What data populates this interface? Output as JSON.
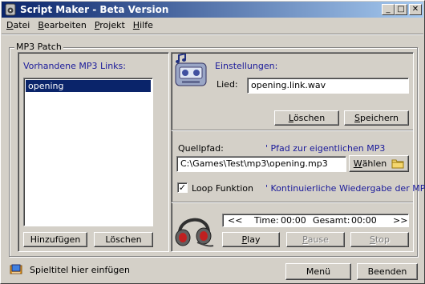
{
  "window": {
    "title": "Script Maker - Beta Version"
  },
  "titlebar": {
    "minimize": "_",
    "maximize": "□",
    "close": "✕"
  },
  "menu": [
    {
      "label": "Datei",
      "accel": "D",
      "rest": "atei"
    },
    {
      "label": "Bearbeiten",
      "accel": "B",
      "rest": "earbeiten"
    },
    {
      "label": "Projekt",
      "accel": "P",
      "rest": "rojekt"
    },
    {
      "label": "Hilfe",
      "accel": "H",
      "rest": "ilfe"
    }
  ],
  "group": {
    "label": "MP3 Patch"
  },
  "links": {
    "heading": "Vorhandene MP3 Links:",
    "items": [
      "opening"
    ],
    "add_button": "Hinzufügen",
    "delete_button": "Löschen"
  },
  "settings": {
    "heading": "Einstellungen:",
    "song_label": "Lied:",
    "song_value": "opening.link.wav",
    "delete_button": {
      "accel": "L",
      "rest": "öschen"
    },
    "save_button": {
      "accel": "S",
      "rest": "peichern"
    }
  },
  "source": {
    "label": "Quellpfad:",
    "hint": "' Pfad zur eigentlichen MP3",
    "path_value": "C:\\Games\\Test\\mp3\\opening.mp3",
    "choose_button": {
      "accel": "W",
      "rest": "ählen"
    },
    "loop_label": "Loop Funktion",
    "loop_checked": true,
    "loop_hint": "' Kontinuierliche Wiedergabe der MP3"
  },
  "player": {
    "prev": "<<",
    "next": ">>",
    "time_label": "Time:",
    "time_value": "00:00",
    "total_label": "Gesamt:",
    "total_value": "00:00",
    "play": {
      "accel": "P",
      "rest": "lay"
    },
    "pause": {
      "accel": "P",
      "rest": "ause"
    },
    "stop": {
      "accel": "S",
      "rest": "top"
    }
  },
  "footer": {
    "hint": "Spieltitel hier einfügen",
    "menu_button": "Menü",
    "exit_button": "Beenden"
  }
}
